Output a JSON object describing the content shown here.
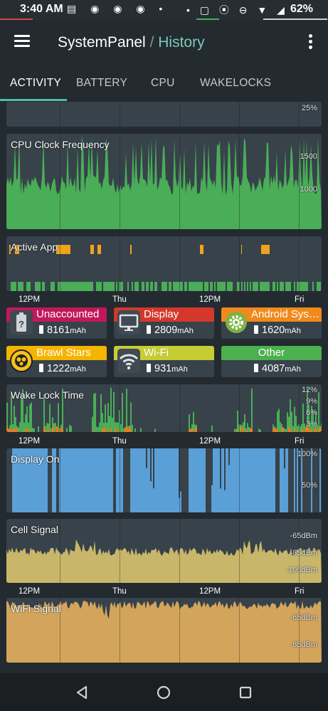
{
  "status_bar": {
    "time": "3:40 AM",
    "left_icons": "▤ ◉ ◉ ◉ •",
    "right_icons": "• ▢ ⦿ ⊖ ▼ ◢",
    "battery_pct": "62%"
  },
  "app_bar": {
    "app_name": "SystemPanel",
    "separator": " / ",
    "page": "History"
  },
  "tabs": [
    {
      "label": "ACTIVITY"
    },
    {
      "label": "BATTERY"
    },
    {
      "label": "CPU"
    },
    {
      "label": "WAKELOCKS"
    }
  ],
  "top_partial_card": {
    "y_label": "25%"
  },
  "cpu_card": {
    "title": "CPU Clock Frequency",
    "y_labels": [
      "1500",
      "1000"
    ]
  },
  "active_app_card": {
    "title": "Active App"
  },
  "x_axis_labels": [
    "12PM",
    "Thu",
    "12PM",
    "Fri"
  ],
  "battery_usage": [
    {
      "name": "Unaccounted",
      "value": "8161",
      "unit": "mAh",
      "color": "#c2185b",
      "icon": "unknown-battery-icon"
    },
    {
      "name": "Display",
      "value": "2809",
      "unit": "mAh",
      "color": "#d4382a",
      "icon": "monitor-icon"
    },
    {
      "name": "Android Sys…",
      "value": "1620",
      "unit": "mAh",
      "color": "#f08a1c",
      "icon": "gear-icon"
    },
    {
      "name": "Brawl Stars",
      "value": "1222",
      "unit": "mAh",
      "color": "#f5b400",
      "icon": "brawl-stars-icon"
    },
    {
      "name": "Wi-Fi",
      "value": "931",
      "unit": "mAh",
      "color": "#c6cc34",
      "icon": "wifi-icon"
    },
    {
      "name": "Other",
      "value": "4087",
      "unit": "mAh",
      "color": "#4caf50",
      "icon": "none"
    }
  ],
  "wakelock_card": {
    "title": "Wake Lock Time",
    "y_labels": [
      "12%",
      "9%",
      "6%",
      "3%"
    ]
  },
  "display_card": {
    "title": "Display On",
    "y_labels": [
      "100%",
      "50%"
    ]
  },
  "cell_card": {
    "title": "Cell Signal",
    "y_labels": [
      "-65dBm",
      "-85dBm",
      "-105dBm"
    ]
  },
  "wifi_card": {
    "title": "WiFi Signal",
    "y_labels": [
      "-65dBm",
      "-85dBm"
    ]
  },
  "colors": {
    "cpu": "#4aad57",
    "active_app": "#f0a21c",
    "wakelock_green": "#4aad57",
    "wakelock_orange": "#f07a1c",
    "display": "#5a9fd6",
    "cell": "#c8b66a",
    "wifi": "#d3a55c",
    "tab_indicator": "#4dbfa5"
  }
}
